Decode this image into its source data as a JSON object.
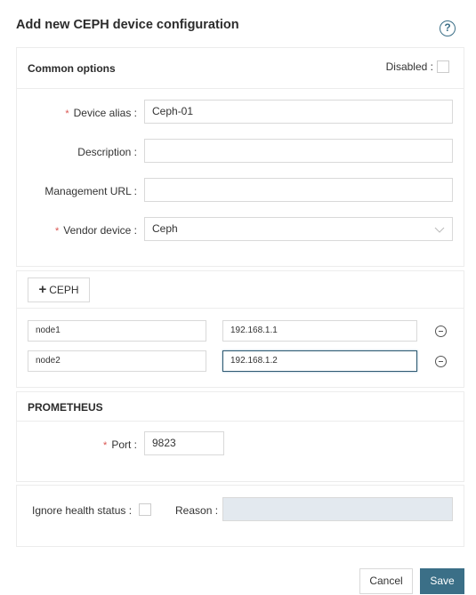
{
  "header": {
    "title": "Add new CEPH device configuration",
    "help_icon": "question-circle-icon"
  },
  "common": {
    "title": "Common options",
    "disabled_label": "Disabled",
    "disabled_checked": false,
    "fields": {
      "alias_label": "Device alias",
      "alias_value": "Ceph-01",
      "description_label": "Description",
      "description_value": "",
      "url_label": "Management URL",
      "url_value": "",
      "vendor_label": "Vendor device",
      "vendor_value": "Ceph"
    },
    "required_mark": "*",
    "colon": ":"
  },
  "ceph": {
    "add_label": "CEPH",
    "add_icon": "+",
    "nodes": [
      {
        "name": "node1",
        "ip": "192.168.1.1"
      },
      {
        "name": "node2",
        "ip": "192.168.1.2"
      }
    ]
  },
  "prometheus": {
    "title": "PROMETHEUS",
    "port_label": "Port",
    "port_value": "9823"
  },
  "health": {
    "ignore_label": "Ignore health status",
    "ignore_checked": false,
    "reason_label": "Reason",
    "reason_value": ""
  },
  "footer": {
    "cancel_label": "Cancel",
    "save_label": "Save"
  },
  "colors": {
    "primary": "#3b6f87",
    "required": "#d9534f",
    "disabled_input": "#e3e9ef"
  }
}
